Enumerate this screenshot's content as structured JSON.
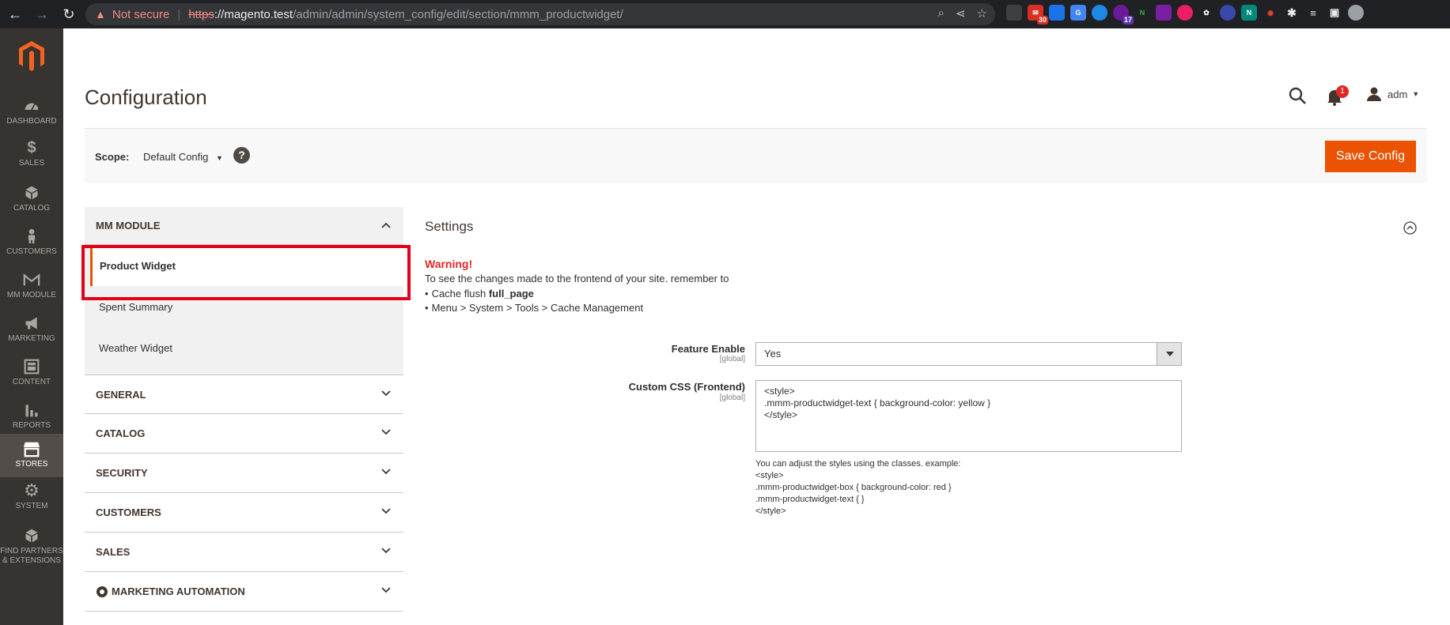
{
  "browser": {
    "not_secure": "Not secure",
    "url_scheme": "https",
    "url_host": "://magento.test",
    "url_path": "/admin/admin/system_config/edit/section/mmm_productwidget/",
    "ext_badge_mail": "30",
    "ext_badge_other": "17"
  },
  "admin_menu": [
    {
      "label": "DASHBOARD",
      "icon": "dashboard-icon"
    },
    {
      "label": "SALES",
      "icon": "dollar-icon"
    },
    {
      "label": "CATALOG",
      "icon": "box-icon"
    },
    {
      "label": "CUSTOMERS",
      "icon": "person-icon"
    },
    {
      "label": "MM MODULE",
      "icon": "module-icon"
    },
    {
      "label": "MARKETING",
      "icon": "megaphone-icon"
    },
    {
      "label": "CONTENT",
      "icon": "layout-icon"
    },
    {
      "label": "REPORTS",
      "icon": "bar-chart-icon"
    },
    {
      "label": "STORES",
      "icon": "store-icon"
    },
    {
      "label": "SYSTEM",
      "icon": "gear-icon"
    },
    {
      "label": "FIND PARTNERS & EXTENSIONS",
      "icon": "extensions-icon"
    }
  ],
  "header": {
    "title": "Configuration",
    "notification_count": "1",
    "user": "adm"
  },
  "actions": {
    "scope_label": "Scope:",
    "scope_value": "Default Config",
    "help": "?",
    "save_label": "Save Config"
  },
  "tabs": {
    "group_open": "MM MODULE",
    "sub_items": [
      "Product Widget",
      "Spent Summary",
      "Weather Widget"
    ],
    "groups": [
      "GENERAL",
      "CATALOG",
      "SECURITY",
      "CUSTOMERS",
      "SALES",
      "MARKETING AUTOMATION"
    ]
  },
  "section": {
    "title": "Settings",
    "warning_title": "Warning!",
    "warning_text": "To see the changes made to the frontend of your site. remember to",
    "bullet1_prefix": "Cache flush ",
    "bullet1_bold": "full_page",
    "bullet2": "Menu > System > Tools > Cache Management"
  },
  "fields": {
    "feature_label": "Feature Enable",
    "feature_scope": "[global]",
    "feature_value": "Yes",
    "css_label": "Custom CSS (Frontend)",
    "css_scope": "[global]",
    "css_value": "<style>\n.mmm-productwidget-text { background-color: yellow }\n</style>",
    "css_note_1": "You can adjust the styles using the classes. example:",
    "css_note_2": "<style>",
    "css_note_3": ".mmm-productwidget-box { background-color: red }",
    "css_note_4": ".mmm-productwidget-text { }",
    "css_note_5": "</style>"
  },
  "colors": {
    "accent": "#eb5202",
    "sidebar_bg": "#373330",
    "warning": "#e22626",
    "highlight": "#e3001b"
  }
}
